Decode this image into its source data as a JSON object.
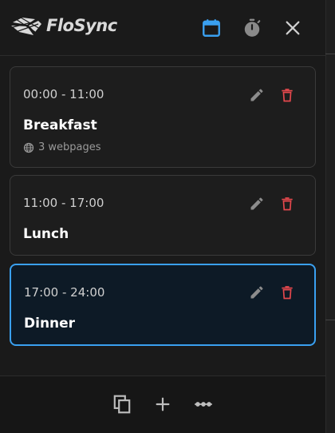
{
  "app": {
    "name": "FloSync"
  },
  "header": {
    "buttons": [
      {
        "icon": "calendar-icon",
        "active": true,
        "color": "#3aa0f0"
      },
      {
        "icon": "timer-icon",
        "active": false,
        "color": "#8a8a8a"
      },
      {
        "icon": "close-icon",
        "active": false,
        "color": "#cfcfcf"
      }
    ]
  },
  "schedule": [
    {
      "time": "00:00 - 11:00",
      "name": "Breakfast",
      "meta": "3 webpages",
      "selected": false
    },
    {
      "time": "11:00 - 17:00",
      "name": "Lunch",
      "meta": "",
      "selected": false
    },
    {
      "time": "17:00 - 24:00",
      "name": "Dinner",
      "meta": "",
      "selected": true
    }
  ],
  "card_actions": {
    "edit_icon": "pencil-icon",
    "delete_icon": "trash-icon",
    "edit_color": "#8c8c8c",
    "delete_color": "#e5484d"
  },
  "footer": {
    "buttons": [
      {
        "icon": "copy-icon"
      },
      {
        "icon": "plus-icon"
      },
      {
        "icon": "more-icon"
      }
    ]
  },
  "colors": {
    "accent": "#3aa0f0",
    "background": "#1a1a1a",
    "danger": "#e5484d"
  }
}
